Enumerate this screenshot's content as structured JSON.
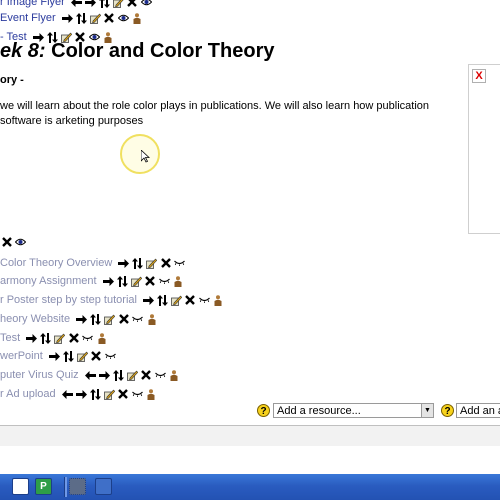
{
  "top_items": [
    {
      "label": "r Image Flyer",
      "icons": [
        "left-arrow",
        "right-arrow",
        "move-updown",
        "edit",
        "delete",
        "eye"
      ]
    },
    {
      "label": "Event Flyer",
      "icons": [
        "right-arrow",
        "move-updown",
        "edit",
        "delete",
        "eye",
        "person"
      ]
    },
    {
      "label": "- Test",
      "icons": [
        "right-arrow",
        "move-updown",
        "edit",
        "delete",
        "eye",
        "person"
      ]
    }
  ],
  "week": {
    "prefix": "ek 8:",
    "title": " Color and Color Theory",
    "subtitle": "ory -",
    "summary": "we will learn about the role color plays in publications. We will also learn how publication software is arketing purposes"
  },
  "sidebox": {
    "close_label": "X"
  },
  "week_icons": [
    "delete",
    "eye"
  ],
  "items": [
    {
      "label": "Color Theory Overview",
      "icons": [
        "right-arrow",
        "move-updown",
        "edit",
        "delete",
        "hide"
      ]
    },
    {
      "label": "armony Assignment",
      "icons": [
        "right-arrow",
        "move-updown",
        "edit",
        "delete",
        "hide",
        "person"
      ]
    },
    {
      "label": "r Poster step by step tutorial",
      "icons": [
        "right-arrow",
        "move-updown",
        "edit",
        "delete",
        "hide",
        "person"
      ]
    },
    {
      "label": "heory Website",
      "icons": [
        "right-arrow",
        "move-updown",
        "edit",
        "delete",
        "hide",
        "person"
      ]
    },
    {
      "label": "Test",
      "icons": [
        "right-arrow",
        "move-updown",
        "edit",
        "delete",
        "hide",
        "person"
      ]
    },
    {
      "label": "werPoint",
      "icons": [
        "right-arrow",
        "move-updown",
        "edit",
        "delete",
        "hide"
      ]
    },
    {
      "label": "puter Virus Quiz",
      "icons": [
        "left-arrow",
        "right-arrow",
        "move-updown",
        "edit",
        "delete",
        "hide",
        "person"
      ]
    },
    {
      "label": "r Ad upload",
      "icons": [
        "left-arrow",
        "right-arrow",
        "move-updown",
        "edit",
        "delete",
        "hide",
        "person"
      ]
    }
  ],
  "add_controls": {
    "help_label": "?",
    "add_resource": "Add a resource...",
    "add_activity": "Add an a"
  },
  "taskbar": {
    "powerpoint_label": "P"
  },
  "colors": {
    "link": "#2b3b9e",
    "dim_link": "#8a8fb0",
    "taskbar": "#2a5cc0"
  }
}
